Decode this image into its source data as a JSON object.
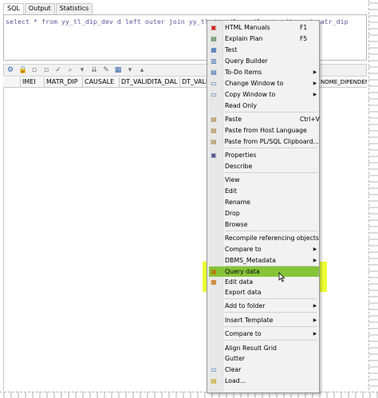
{
  "tabs": [
    {
      "label": "SQL"
    },
    {
      "label": "Output"
    },
    {
      "label": "Statistics"
    }
  ],
  "editor": {
    "sql": "select * from yy_tl_dip_dev d left outer join yy_tl_dip d1 on d1.matr_dip = d.matr_dip"
  },
  "grid": {
    "columns": [
      "",
      "IMEI",
      "MATR_DIP",
      "CAUSALE",
      "DT_VALIDITA_DAL",
      "DT_VALIDI"
    ],
    "right_column": "NOME_DIPENDENTE"
  },
  "menu": {
    "items": [
      {
        "label": "HTML Manuals",
        "shortcut": "F1",
        "icon": "html-manual-icon"
      },
      {
        "label": "Explain Plan",
        "shortcut": "F5",
        "icon": "explain-plan-icon"
      },
      {
        "label": "Test",
        "icon": "test-icon"
      },
      {
        "label": "Query Builder",
        "icon": "query-builder-icon"
      },
      {
        "label": "To-Do Items",
        "submenu": true,
        "icon": "todo-icon"
      },
      {
        "label": "Change Window to",
        "submenu": true,
        "icon": "window-icon"
      },
      {
        "label": "Copy Window to",
        "submenu": true,
        "icon": "copy-window-icon"
      },
      {
        "label": "Read Only"
      },
      {
        "label": "Paste",
        "shortcut": "Ctrl+V",
        "icon": "paste-icon"
      },
      {
        "label": "Paste from Host Language",
        "icon": "paste-host-icon"
      },
      {
        "label": "Paste from PL/SQL Clipboard...",
        "icon": "paste-plsql-icon"
      },
      {
        "label": "Properties",
        "icon": "properties-icon"
      },
      {
        "label": "Describe"
      },
      {
        "label": "View"
      },
      {
        "label": "Edit"
      },
      {
        "label": "Rename"
      },
      {
        "label": "Drop"
      },
      {
        "label": "Browse"
      },
      {
        "label": "Recompile referencing objects"
      },
      {
        "label": "Compare to",
        "submenu": true
      },
      {
        "label": "DBMS_Metadata",
        "submenu": true
      },
      {
        "label": "Query data",
        "icon": "query-data-icon"
      },
      {
        "label": "Edit data",
        "icon": "edit-data-icon"
      },
      {
        "label": "Export data"
      },
      {
        "label": "Add to folder",
        "submenu": true
      },
      {
        "label": "Insert Template",
        "submenu": true
      },
      {
        "label": "Compare to",
        "submenu": true
      },
      {
        "label": "Align Result Grid"
      },
      {
        "label": "Gutter"
      },
      {
        "label": "Clear",
        "icon": "clear-icon"
      },
      {
        "label": "Load...",
        "icon": "load-icon"
      }
    ]
  },
  "colors": {
    "highlight": "#e6ff00",
    "selected_row": "#86c43a",
    "sql_text": "#5a5aa0"
  }
}
